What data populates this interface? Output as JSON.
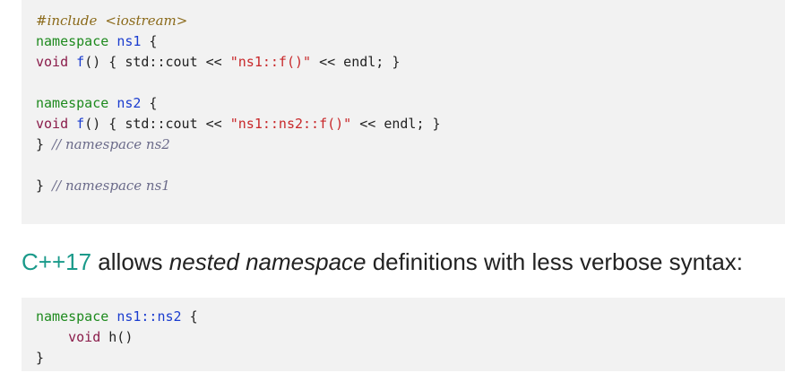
{
  "code_block_1": {
    "lines": [
      {
        "include_directive": "#include",
        "include_target": "<iostream>"
      },
      {
        "kw": "namespace",
        "name": "ns1",
        "rest": " {"
      },
      {
        "kw": "void",
        "fn": "f",
        "before_str": "() { std::cout << ",
        "str": "\"ns1::f()\"",
        "after_str": " << endl; }"
      },
      {
        "kw": "namespace",
        "name": "ns2",
        "rest": " {"
      },
      {
        "kw": "void",
        "fn": "f",
        "before_str": "() { std::cout << ",
        "str": "\"ns1::ns2::f()\"",
        "after_str": " << endl; }"
      },
      {
        "brace": "} ",
        "comment": "// namespace ns2"
      },
      {
        "brace": "} ",
        "comment": "// namespace ns1"
      }
    ]
  },
  "prose": {
    "accent": "C++17",
    "text_before_em": " allows ",
    "em": "nested namespace",
    "text_after_em": " definitions with less verbose syntax:"
  },
  "code_block_2": {
    "line1": {
      "kw": "namespace",
      "ns_a": "ns1",
      "sep": "::",
      "ns_b": "ns2",
      "rest": " {"
    },
    "line2": {
      "indent": "    ",
      "kw": "void",
      "rest": " h()"
    },
    "line3": {
      "brace": "}"
    }
  },
  "colors": {
    "code_background": "#f2f2f2",
    "keyword_namespace": "#1e8a1e",
    "keyword_void": "#8a1c4a",
    "identifier": "#1a3ccf",
    "string": "#c8282a",
    "comment": "#6b6b8a",
    "accent": "#1a9a8a"
  }
}
